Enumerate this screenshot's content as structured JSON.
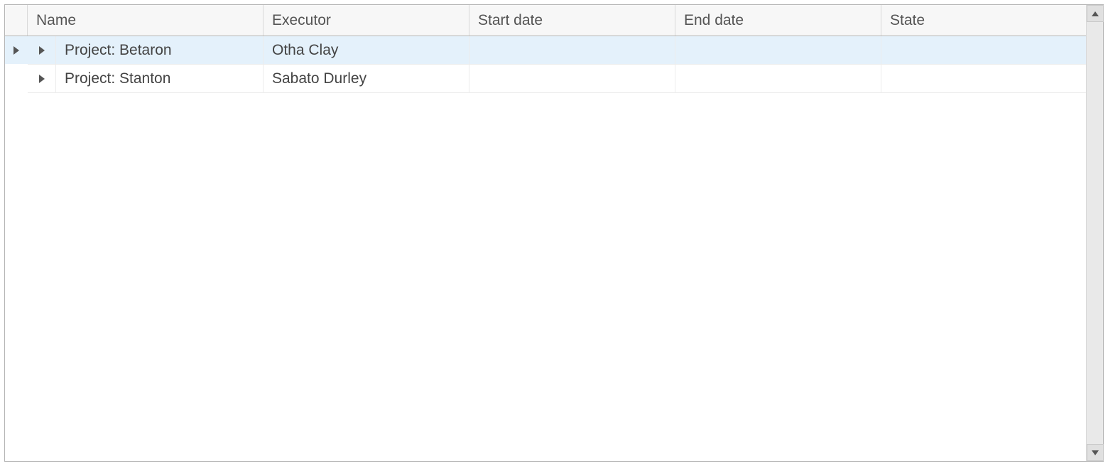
{
  "columns": {
    "name": "Name",
    "executor": "Executor",
    "start_date": "Start date",
    "end_date": "End date",
    "state": "State"
  },
  "rows": [
    {
      "selected": true,
      "indicator": true,
      "name": "Project: Betaron",
      "executor": "Otha Clay",
      "start_date": "",
      "end_date": "",
      "state": ""
    },
    {
      "selected": false,
      "indicator": false,
      "name": "Project: Stanton",
      "executor": "Sabato Durley",
      "start_date": "",
      "end_date": "",
      "state": ""
    }
  ]
}
